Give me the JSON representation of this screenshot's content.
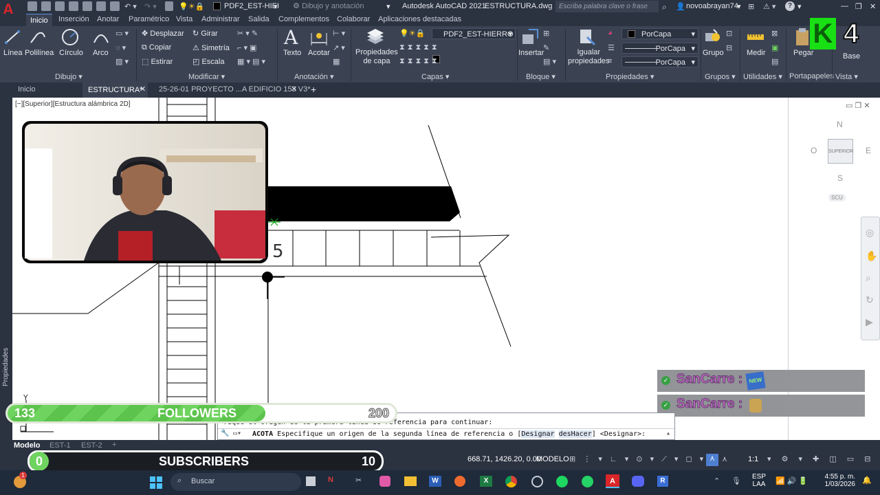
{
  "titlebar": {
    "app_logo": "A",
    "layer_combo": "PDF2_EST-HIEI",
    "workspace": "Dibujo y anotación",
    "app_title": "Autodesk AutoCAD 2021",
    "file_title": "ESTRUCTURA.dwg",
    "search_placeholder": "Escriba palabra clave o frase",
    "user": "novoabrayan74",
    "help": "?"
  },
  "ribbon_tabs": [
    "Inicio",
    "Inserción",
    "Anotar",
    "Paramétrico",
    "Vista",
    "Administrar",
    "Salida",
    "Complementos",
    "Colaborar",
    "Aplicaciones destacadas"
  ],
  "ribbon": {
    "draw": {
      "panel": "Dibujo",
      "linea": "Línea",
      "polilinea": "Polilínea",
      "circulo": "Círculo",
      "arco": "Arco"
    },
    "modify": {
      "panel": "Modificar",
      "desplazar": "Desplazar",
      "girar": "Girar",
      "copiar": "Copiar",
      "simetria": "Simetría",
      "estirar": "Estirar",
      "escala": "Escala"
    },
    "annotation": {
      "panel": "Anotación",
      "texto": "Texto",
      "acotar": "Acotar"
    },
    "layers": {
      "panel": "Capas",
      "props_line1": "Propiedades",
      "props_line2": "de capa",
      "current_layer": "PDF2_EST-HIERRO"
    },
    "block": {
      "panel": "Bloque",
      "insertar": "Insertar"
    },
    "properties": {
      "panel": "Propiedades",
      "igualar_line1": "Igualar",
      "igualar_line2": "propiedades",
      "color": "PorCapa",
      "linetype": "PorCapa",
      "lineweight": "PorCapa"
    },
    "groups": {
      "panel": "Grupos",
      "grupo": "Grupo"
    },
    "utilities": {
      "panel": "Utilidades",
      "medir": "Medir"
    },
    "clipboard": {
      "panel": "Portapapeles",
      "pegar": "Pegar"
    },
    "view": {
      "panel": "Vista",
      "base": "Base"
    }
  },
  "file_tabs": [
    "Inicio",
    "ESTRUCTURA*",
    "25-26-01 PROYECTO ...A EDIFICIO 153 V3*"
  ],
  "viewport": {
    "label": "[−][Superior][Estructura alámbrica 2D]",
    "side_label": "Propiedades",
    "dimension_text": "5",
    "ucs_y": "Y"
  },
  "viewcube": {
    "n": "N",
    "s": "S",
    "e": "E",
    "w": "O",
    "face": "SUPERIOR",
    "ucs": "SCU"
  },
  "command": {
    "history": "rique el origen de la primera línea de referencia para continuar:",
    "prompt_cmd": "ACOTA",
    "prompt_text": "Especifique un origen de la segunda línea de referencia o [",
    "opt1": "Designar",
    "opt2": "desHacer",
    "prompt_end": "] <Designar>:"
  },
  "status": {
    "model_tab": "Modelo",
    "layout1": "EST-1",
    "layout2": "EST-2",
    "coords": "668.71, 1426.20, 0.00",
    "model": "MODELO",
    "scale": "1:1"
  },
  "taskbar": {
    "search": "Buscar",
    "lang1": "ESP",
    "lang2": "LAA",
    "time": "4:55 p. m.",
    "date": "1/03/2026",
    "notif": "1"
  },
  "stream": {
    "followers_current": "133",
    "followers_label": "FOLLOWERS",
    "followers_goal": "200",
    "followers_progress": 0.665,
    "subs_current": "0",
    "subs_label": "SUBSCRIBERS",
    "subs_goal": "10",
    "subs_progress": 0.0,
    "chat_user1": "SanCarre :",
    "chat_user2": "SanCarre :",
    "logo_letter": "K",
    "logo_num": "4"
  },
  "colors": {
    "accent": "#5a8fd6",
    "ribbon": "#3b4353",
    "follower_bar": "#6fd45f",
    "autocad_red": "#d8262a"
  }
}
